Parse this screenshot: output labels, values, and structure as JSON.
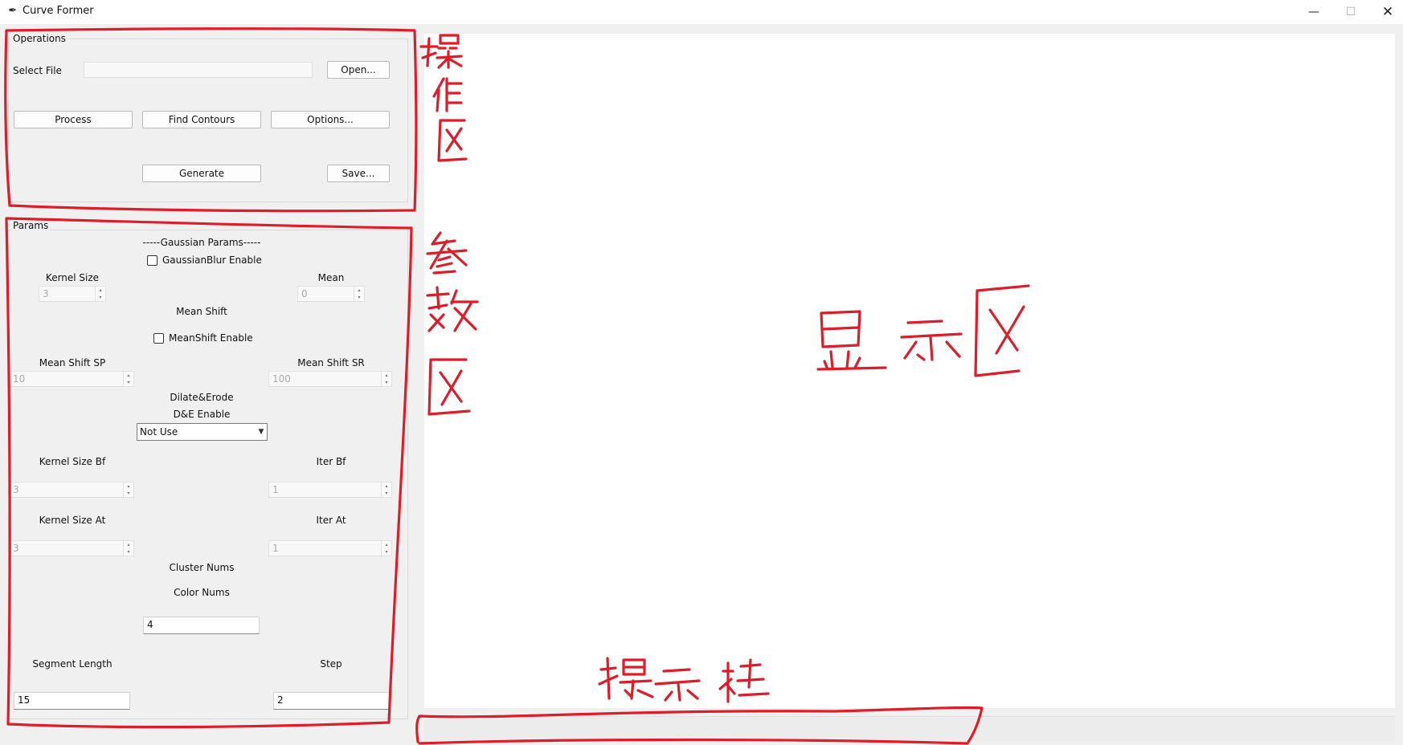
{
  "window": {
    "title": "Curve Former",
    "minimize": "—",
    "maximize": "☐",
    "close": "✕"
  },
  "operations": {
    "legend": "Operations",
    "select_file_label": "Select File",
    "file_path": "",
    "open_button": "Open...",
    "process_button": "Process",
    "find_contours_button": "Find Contours",
    "options_button": "Options...",
    "generate_button": "Generate",
    "save_button": "Save..."
  },
  "params": {
    "legend": "Params",
    "gaussian_header": "-----Gaussian Params-----",
    "gaussian_enable": "GaussianBlur Enable",
    "kernel_size_label": "Kernel Size",
    "kernel_size_value": "3",
    "mean_label": "Mean",
    "mean_value": "0",
    "mean_shift_header": "Mean Shift",
    "mean_shift_enable": "MeanShift Enable",
    "mean_shift_sp_label": "Mean Shift SP",
    "mean_shift_sp_value": "10",
    "mean_shift_sr_label": "Mean Shift SR",
    "mean_shift_sr_value": "100",
    "dilate_erode_header": "Dilate&Erode",
    "de_enable_label": "D&E Enable",
    "de_enable_selected": "Not Use",
    "kernel_size_bf_label": "Kernel Size Bf",
    "kernel_size_bf_value": "3",
    "iter_bf_label": "Iter Bf",
    "iter_bf_value": "1",
    "kernel_size_at_label": "Kernel Size At",
    "kernel_size_at_value": "3",
    "iter_at_label": "Iter At",
    "iter_at_value": "1",
    "cluster_nums_label": "Cluster Nums",
    "color_nums_label": "Color Nums",
    "color_nums_value": "4",
    "segment_length_label": "Segment Length",
    "segment_length_value": "15",
    "step_label": "Step",
    "step_value": "2"
  },
  "annotations": {
    "operations_area": "操作区",
    "params_area": "参数区",
    "display_area": "显示区",
    "status_bar": "提示栏",
    "ink_color": "#dd1d2a"
  },
  "icons": {
    "app": "feather-icon",
    "spin_up": "▴",
    "spin_down": "▾",
    "dropdown": "chevron-down-icon"
  }
}
